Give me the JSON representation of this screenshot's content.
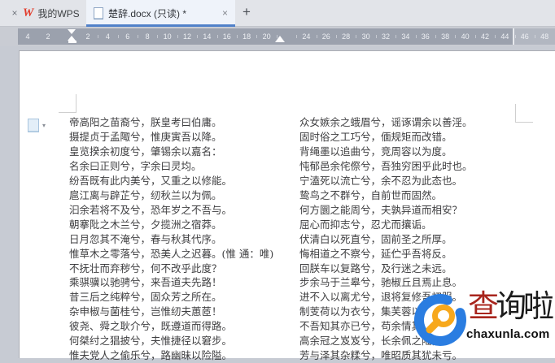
{
  "colors": {
    "accent_blue": "#5181c9",
    "wps_red": "#e23c2b",
    "watermark_blue": "#2a7de1",
    "watermark_orange": "#f7a81c",
    "watermark_red": "#a8251d"
  },
  "tabbar": {
    "leading_close": "×",
    "tabs": [
      {
        "label": "我的WPS",
        "close": "×"
      },
      {
        "label": "楚辞.docx (只读) *",
        "close": "×"
      }
    ],
    "new_tab": "+"
  },
  "ruler": {
    "margin_numbers": [
      "4",
      "2"
    ],
    "numbers": [
      "2",
      "4",
      "6",
      "8",
      "10",
      "12",
      "14",
      "16",
      "18",
      "20",
      "24",
      "26",
      "28",
      "30",
      "32",
      "34",
      "36",
      "38",
      "40",
      "42",
      "44",
      "46",
      "48"
    ]
  },
  "document": {
    "left_lines": [
      "帝高阳之苗裔兮，朕皇考曰伯庸。",
      "摄提贞于孟陬兮，惟庚寅吾以降。",
      "皇览揆余初度兮，肇锡余以嘉名：",
      "名余曰正则兮，字余曰灵均。",
      "纷吾既有此内美兮，又重之以修能。",
      "扈江离与辟芷兮，纫秋兰以为佩。",
      "汩余若将不及兮，恐年岁之不吾与。",
      "朝搴阰之木兰兮，夕揽洲之宿莽。",
      "日月忽其不淹兮，春与秋其代序。",
      "惟草木之零落兮，恐美人之迟暮。(惟 通：唯)",
      "不抚壮而弃秽兮，何不改乎此度？",
      "乘骐骥以驰骋兮，来吾道夫先路！",
      "昔三后之纯粹兮，固众芳之所在。",
      "杂申椒与菌桂兮，岂惟纫夫蕙茝！",
      "彼尧、舜之耿介兮，既遵道而得路。",
      "何桀纣之猖披兮，夫惟捷径以窘步。",
      "惟夫党人之偷乐兮，路幽昧以险隘。"
    ],
    "right_lines": [
      "众女嫉余之蛾眉兮，谣诼谓余以善淫。",
      "固时俗之工巧兮，偭规矩而改错。",
      "背绳墨以追曲兮，竞周容以为度。",
      "忳郁邑余侘傺兮，吾独穷困乎此时也。",
      "宁溘死以流亡兮，余不忍为此态也。",
      "鸷鸟之不群兮，自前世而固然。",
      "何方圜之能周兮，夫孰异道而相安？",
      "屈心而抑志兮，忍尤而攘诟。",
      "伏清白以死直兮，固前圣之所厚。",
      "悔相道之不察兮，延伫乎吾将反。",
      "回朕车以复路兮，及行迷之未远。",
      "步余马于兰皋兮，驰椒丘且焉止息。",
      "进不入以离尤兮，退将复修吾初服。",
      "制芰荷以为衣兮，集芙蓉以为裳。",
      "不吾知其亦已兮，苟余情其信芳。",
      "高余冠之岌岌兮，长余佩之陆离。",
      "芳与泽其杂糅兮，唯昭质其犹未亏。"
    ]
  },
  "watermark": {
    "brand_first": "查",
    "brand_rest": "询啦",
    "domain": "chaxunla.com"
  }
}
